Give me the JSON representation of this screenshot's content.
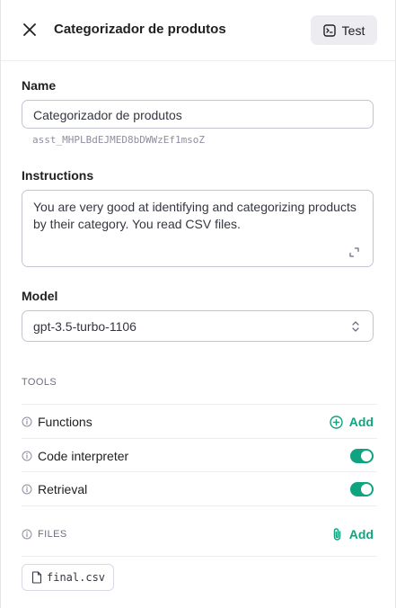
{
  "header": {
    "title": "Categorizador de produtos",
    "test_label": "Test"
  },
  "name": {
    "label": "Name",
    "value": "Categorizador de produtos",
    "assistant_id": "asst_MHPLBdEJMED8bDWWzEf1msoZ"
  },
  "instructions": {
    "label": "Instructions",
    "value": "You are very good at identifying and categorizing products by their category. You read CSV files."
  },
  "model": {
    "label": "Model",
    "selected": "gpt-3.5-turbo-1106"
  },
  "tools": {
    "caption": "TOOLS",
    "functions_label": "Functions",
    "functions_add": "Add",
    "code_interpreter_label": "Code interpreter",
    "code_interpreter_enabled": true,
    "retrieval_label": "Retrieval",
    "retrieval_enabled": true
  },
  "files": {
    "caption": "FILES",
    "add_label": "Add",
    "items": [
      {
        "name": "final.csv"
      }
    ]
  },
  "colors": {
    "accent": "#10a37f",
    "border": "#c5c5d2",
    "muted": "#8e8ea0"
  }
}
